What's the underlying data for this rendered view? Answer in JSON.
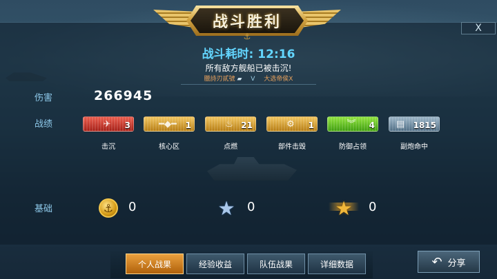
{
  "header": {
    "title": "战斗胜利"
  },
  "summary": {
    "duration_label": "战斗耗时:",
    "duration_value": "12:16",
    "message": "所有敌方舰船已被击沉!",
    "player_name": "臘詩刃貳號",
    "vs": "V",
    "opponent_name": "大选帝侯X"
  },
  "damage": {
    "label": "伤害",
    "value": "266945"
  },
  "record": {
    "label": "战绩",
    "badges": [
      {
        "caption": "击沉",
        "count": "3",
        "color": "#d8392c",
        "icon": "plane-icon"
      },
      {
        "caption": "核心区",
        "count": "1",
        "color": "#e0a52c",
        "icon": "torpedo-icon"
      },
      {
        "caption": "点燃",
        "count": "21",
        "color": "#e0a52c",
        "icon": "fire-icon"
      },
      {
        "caption": "部件击毁",
        "count": "1",
        "color": "#e0a52c",
        "icon": "gear-icon"
      },
      {
        "caption": "防御占领",
        "count": "4",
        "color": "#5fbf20",
        "icon": "chevron-icon"
      },
      {
        "caption": "副炮命中",
        "count": "1815",
        "color": "#6f8ea6",
        "icon": "turret-icon"
      }
    ]
  },
  "basic": {
    "label": "基础",
    "items": [
      {
        "icon": "coin-icon",
        "value": "0"
      },
      {
        "icon": "blue-star-icon",
        "value": "0"
      },
      {
        "icon": "gold-star-icon",
        "value": "0"
      }
    ]
  },
  "tabs": [
    {
      "label": "个人战果",
      "active": true
    },
    {
      "label": "经验收益",
      "active": false
    },
    {
      "label": "队伍战果",
      "active": false
    },
    {
      "label": "详细数据",
      "active": false
    }
  ],
  "share": {
    "label": "分享"
  },
  "close": {
    "label": "X"
  }
}
